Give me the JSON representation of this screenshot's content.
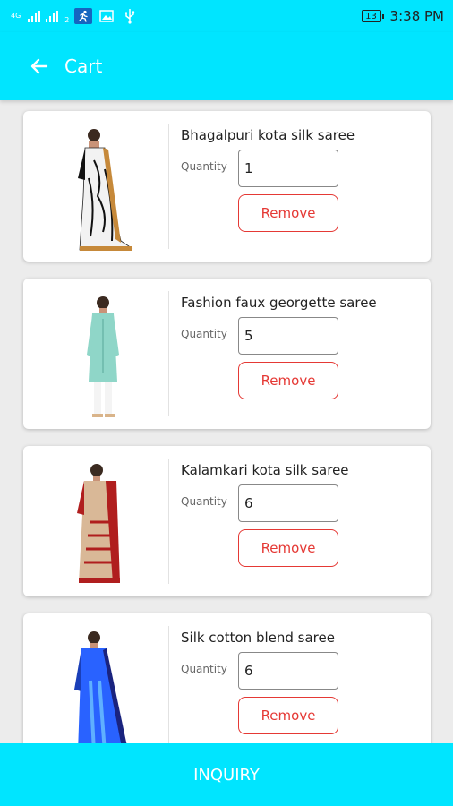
{
  "status_bar": {
    "network": "4G",
    "sim_label": "2",
    "battery": "13",
    "time": "3:38 PM"
  },
  "app_bar": {
    "title": "Cart"
  },
  "cart": {
    "quantity_label": "Quantity",
    "remove_label": "Remove",
    "items": [
      {
        "name": "Bhagalpuri kota silk saree",
        "quantity": "1",
        "image": "saree-white-black-print"
      },
      {
        "name": "Fashion faux georgette saree",
        "quantity": "5",
        "image": "kurti-mint-green"
      },
      {
        "name": "Kalamkari kota silk saree",
        "quantity": "6",
        "image": "saree-beige-red-border"
      },
      {
        "name": "Silk cotton blend saree",
        "quantity": "6",
        "image": "saree-blue"
      }
    ]
  },
  "footer": {
    "inquiry_label": "INQUIRY"
  },
  "colors": {
    "accent": "#00e5ff",
    "danger": "#e53935"
  }
}
